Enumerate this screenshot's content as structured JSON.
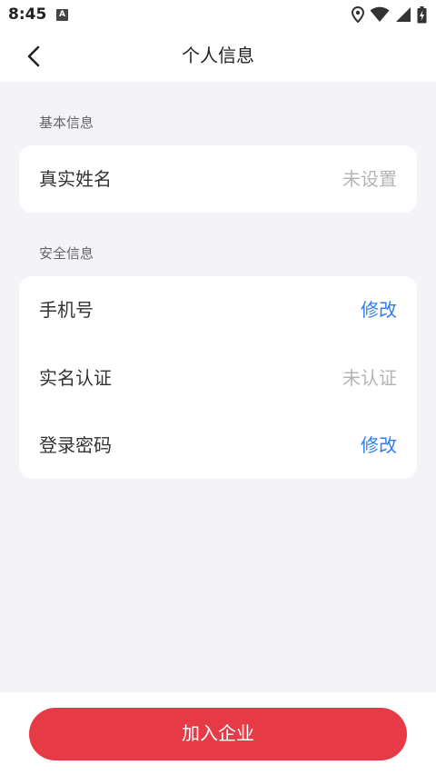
{
  "status_bar": {
    "time": "8:45",
    "notification_icon": "A"
  },
  "nav": {
    "title": "个人信息",
    "back_icon": "chevron-left-icon"
  },
  "sections": {
    "basic": {
      "label": "基本信息",
      "rows": [
        {
          "label": "真实姓名",
          "value": "未设置"
        }
      ]
    },
    "security": {
      "label": "安全信息",
      "rows": [
        {
          "label": "手机号",
          "value": "修改"
        },
        {
          "label": "实名认证",
          "value": "未认证"
        },
        {
          "label": "登录密码",
          "value": "修改"
        }
      ]
    }
  },
  "bottom": {
    "join_button": "加入企业"
  },
  "colors": {
    "accent_red": "#e63a46",
    "link_blue": "#2f7ff0",
    "muted_gray": "#b5b5b5",
    "background": "#f4f4f8"
  }
}
